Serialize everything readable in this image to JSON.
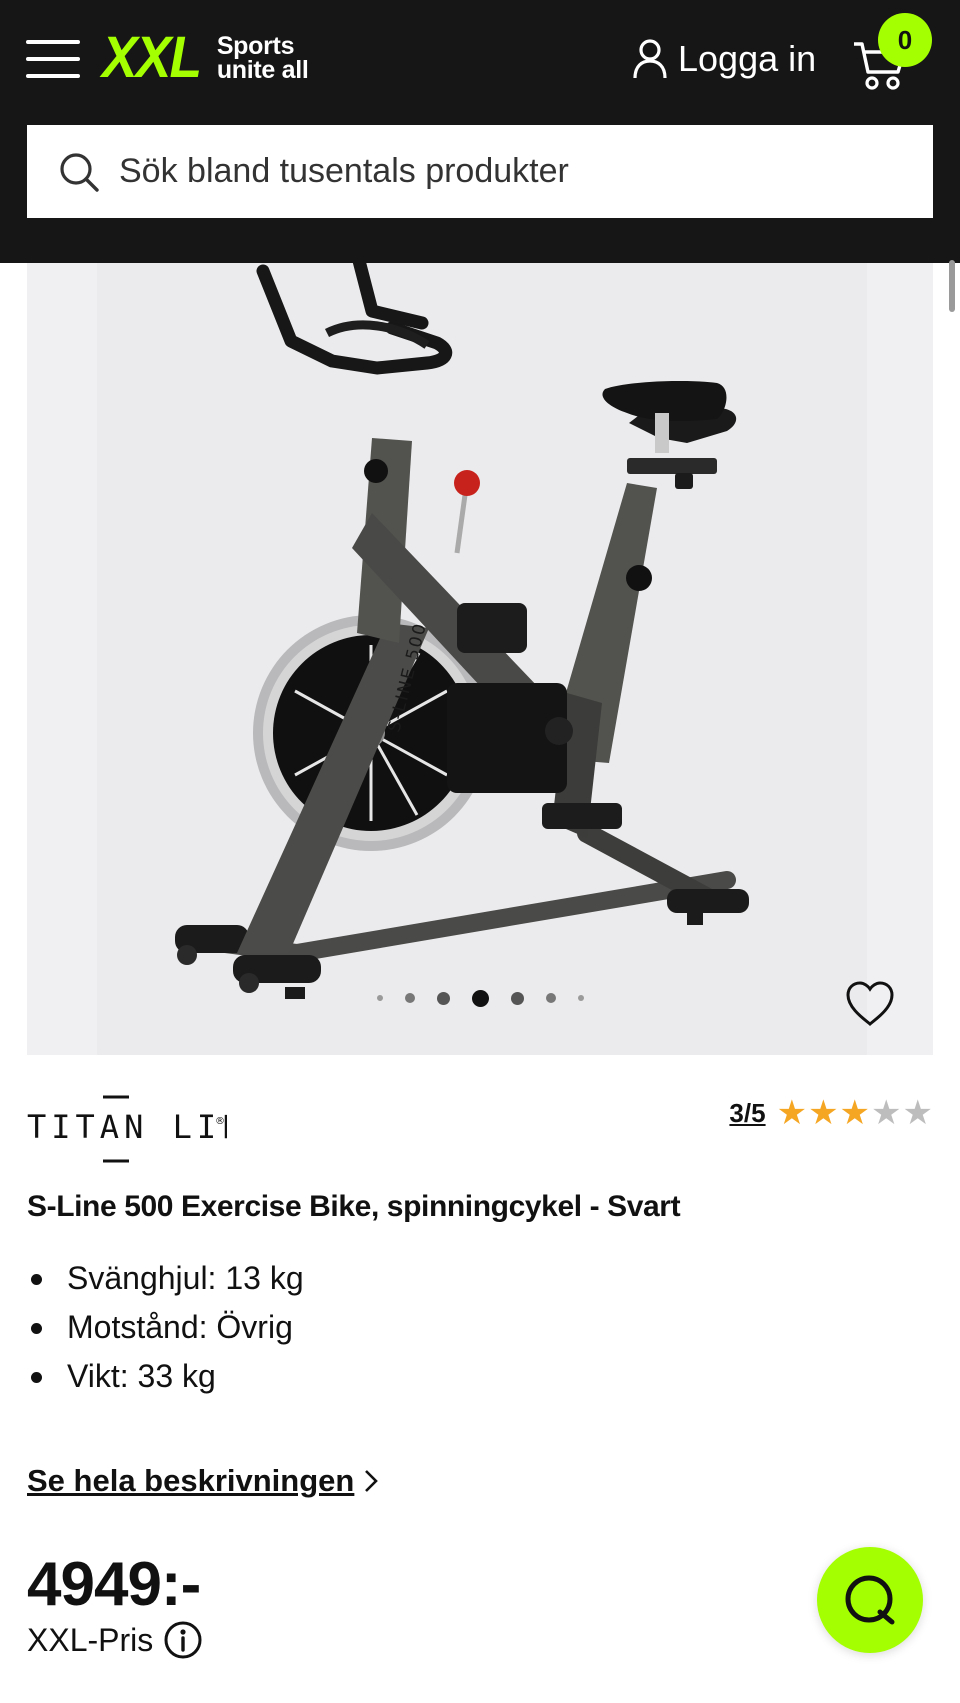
{
  "header": {
    "logo_mark": "XXL",
    "logo_tagline_line1": "Sports",
    "logo_tagline_line2": "unite all",
    "login_label": "Logga in",
    "cart_count": "0"
  },
  "search": {
    "placeholder": "Sök bland tusentals produkter"
  },
  "gallery": {
    "image_count": 7,
    "active_index": 3,
    "bike_frame_text": "S-LINE 500"
  },
  "product": {
    "brand": "TITAN LIFE",
    "brand_mark": "®",
    "rating": "3/5",
    "rating_value": 3,
    "rating_max": 5,
    "title": "S-Line 500 Exercise Bike, spinningcykel - Svart",
    "specs": [
      "Svänghjul: 13 kg",
      "Motstånd: Övrig",
      "Vikt: 33 kg"
    ],
    "description_link": "Se hela beskrivningen",
    "price": "4949:-",
    "price_label": "XXL-Pris"
  },
  "colors": {
    "accent": "#a4ff00",
    "header_bg": "#161616",
    "star_filled": "#f5a623",
    "star_empty": "#bdbdbd"
  },
  "icons": {
    "menu": "menu-icon",
    "user": "user-icon",
    "cart": "cart-icon",
    "search": "search-icon",
    "favorite": "heart-icon",
    "info": "info-icon",
    "chat": "chat-icon",
    "chevron": "chevron-right-icon"
  }
}
